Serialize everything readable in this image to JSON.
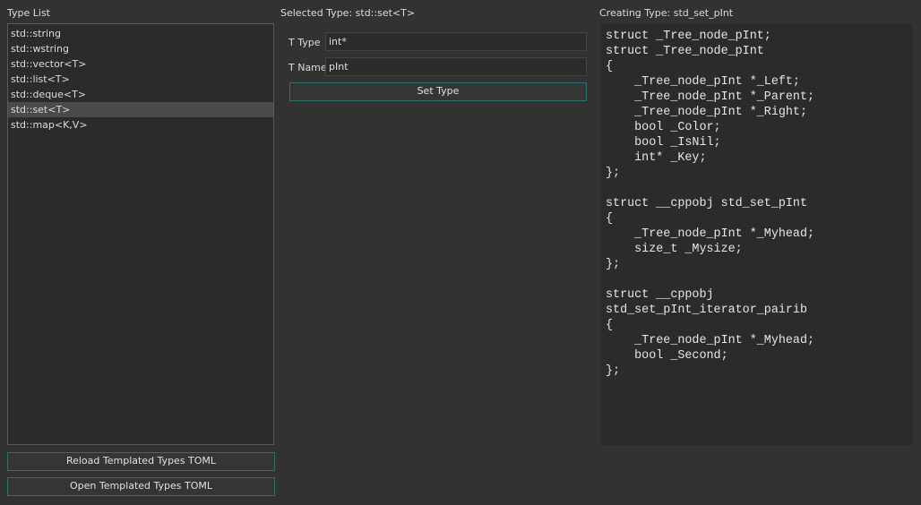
{
  "left": {
    "header": "Type List",
    "items": [
      {
        "label": "std::string"
      },
      {
        "label": "std::wstring"
      },
      {
        "label": "std::vector<T>"
      },
      {
        "label": "std::list<T>"
      },
      {
        "label": "std::deque<T>"
      },
      {
        "label": "std::set<T>"
      },
      {
        "label": "std::map<K,V>"
      }
    ],
    "selected_index": 5,
    "reload_button": "Reload Templated Types TOML",
    "open_button": "Open Templated Types TOML"
  },
  "middle": {
    "header": "Selected Type: std::set<T>",
    "t_type_label": "T Type",
    "t_type_value": "int*",
    "t_name_label": "T Name",
    "t_name_value": "pInt",
    "set_type_button": "Set Type"
  },
  "right": {
    "header": "Creating Type: std_set_pInt",
    "code": "struct _Tree_node_pInt;\nstruct _Tree_node_pInt\n{\n    _Tree_node_pInt *_Left;\n    _Tree_node_pInt *_Parent;\n    _Tree_node_pInt *_Right;\n    bool _Color;\n    bool _IsNil;\n    int* _Key;\n};\n\nstruct __cppobj std_set_pInt\n{\n    _Tree_node_pInt *_Myhead;\n    size_t _Mysize;\n};\n\nstruct __cppobj\nstd_set_pInt_iterator_pairib\n{\n    _Tree_node_pInt *_Myhead;\n    bool _Second;\n};"
  },
  "colors": {
    "background": "#323232",
    "panel": "#2b2b2b",
    "button_border": "#2f6f6c",
    "selection": "#4a4a4a"
  }
}
